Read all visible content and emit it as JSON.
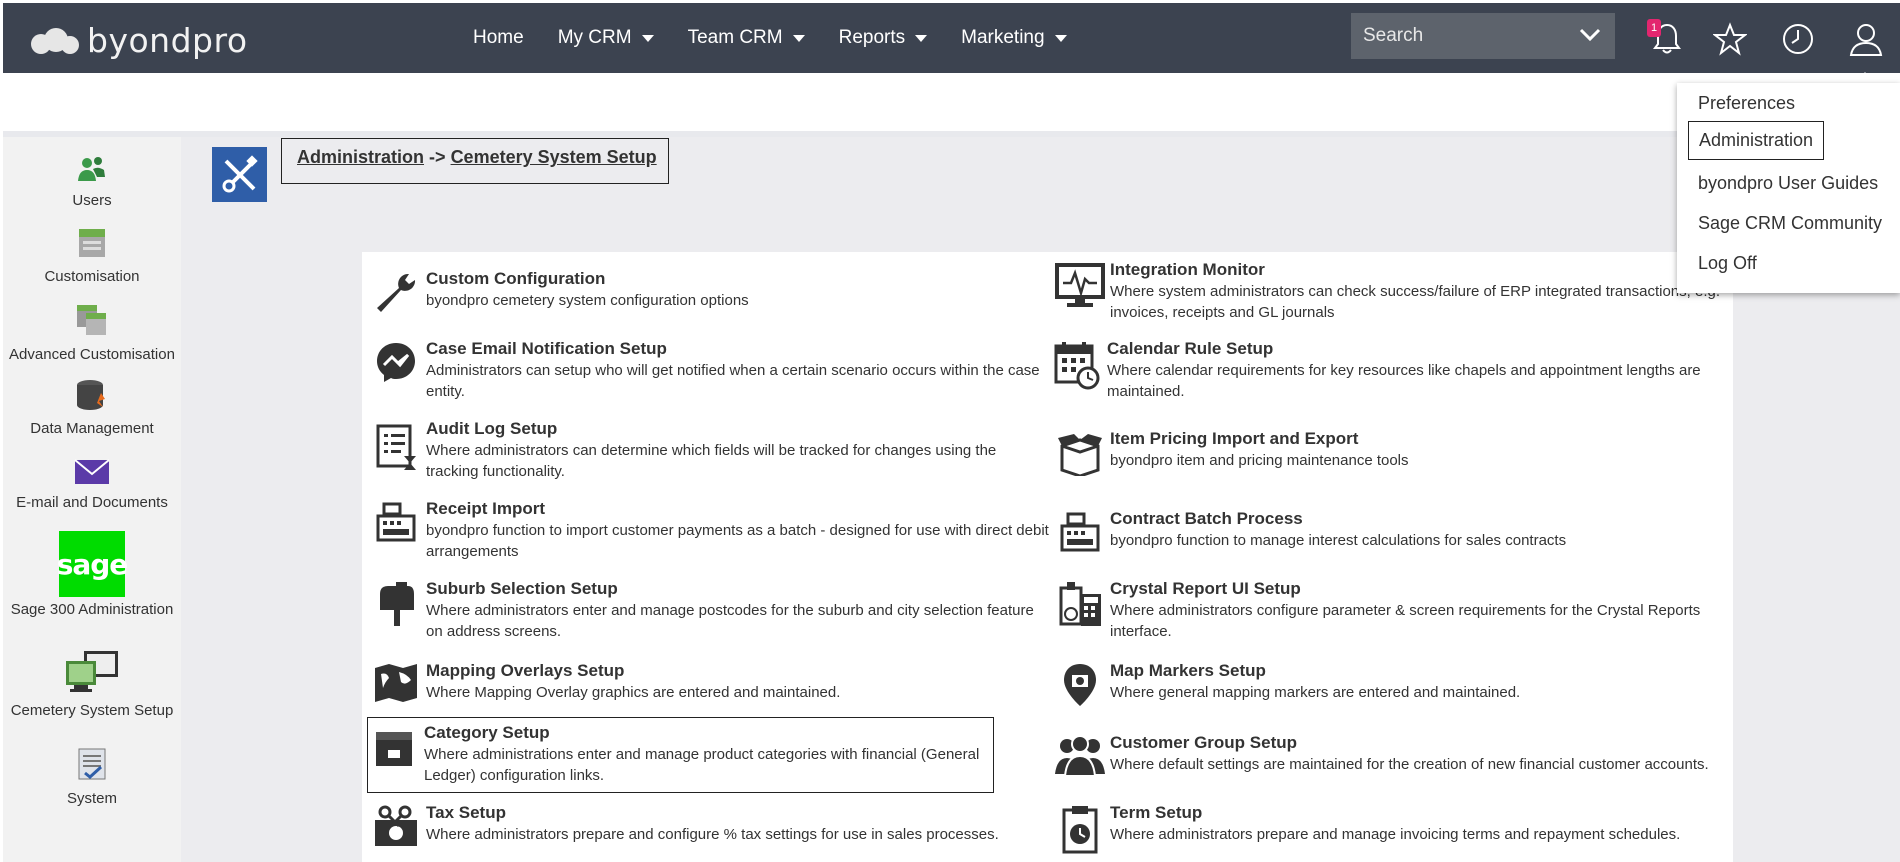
{
  "app": {
    "logo_text": "byondpro"
  },
  "nav": {
    "items": [
      {
        "label": "Home",
        "dropdown": false
      },
      {
        "label": "My CRM",
        "dropdown": true
      },
      {
        "label": "Team CRM",
        "dropdown": true
      },
      {
        "label": "Reports",
        "dropdown": true
      },
      {
        "label": "Marketing",
        "dropdown": true
      }
    ],
    "search_placeholder": "Search",
    "notification_count": "1"
  },
  "user_menu": {
    "items": [
      "Preferences",
      "Administration",
      "byondpro User Guides",
      "Sage CRM Community",
      "Log Off"
    ]
  },
  "sidebar": {
    "items": [
      "Users",
      "Customisation",
      "Advanced Customisation",
      "Data Management",
      "E-mail and Documents",
      "Sage 300 Administration",
      "Cemetery System Setup",
      "System"
    ],
    "sage_logo_text": "sage"
  },
  "breadcrumb": {
    "root": "Administration",
    "separator": "->",
    "current": "Cemetery System Setup"
  },
  "entries_left": [
    {
      "title": "Custom Configuration",
      "desc": "byondpro cemetery system configuration options"
    },
    {
      "title": "Case Email Notification Setup",
      "desc": "Administrators can setup who will get notified when a certain scenario occurs within the case entity."
    },
    {
      "title": "Audit Log Setup",
      "desc": "Where administrators can determine which fields will be tracked for changes using the tracking functionality."
    },
    {
      "title": "Receipt Import",
      "desc": "byondpro function to import customer payments as a batch - designed for use with direct debit arrangements"
    },
    {
      "title": "Suburb Selection Setup",
      "desc": "Where administrators enter and manage postcodes for the suburb and city selection feature on address screens."
    },
    {
      "title": "Mapping Overlays Setup",
      "desc": "Where Mapping Overlay graphics are entered and maintained."
    },
    {
      "title": "Category Setup",
      "desc": "Where administrations enter and manage product categories with financial (General Ledger) configuration links."
    },
    {
      "title": "Tax Setup",
      "desc": "Where administrators prepare and configure % tax settings for use in sales processes."
    }
  ],
  "entries_right": [
    {
      "title": "Integration Monitor",
      "desc": "Where system administrators can check success/failure of ERP integrated transactions, e.g. invoices, receipts and GL journals"
    },
    {
      "title": "Calendar Rule Setup",
      "desc": "Where calendar requirements for key resources like chapels and appointment lengths are maintained."
    },
    {
      "title": "Item Pricing Import and Export",
      "desc": "byondpro item and pricing maintenance tools"
    },
    {
      "title": "Contract Batch Process",
      "desc": "byondpro function to manage interest calculations for sales contracts"
    },
    {
      "title": "Crystal Report UI Setup",
      "desc": "Where administrators configure parameter & screen requirements for the Crystal Reports interface."
    },
    {
      "title": "Map Markers Setup",
      "desc": "Where general mapping markers are entered and maintained."
    },
    {
      "title": "Customer Group Setup",
      "desc": "Where default settings are maintained for the creation of new financial customer accounts."
    },
    {
      "title": "Term Setup",
      "desc": "Where administrators prepare and manage invoicing terms and repayment schedules."
    }
  ]
}
